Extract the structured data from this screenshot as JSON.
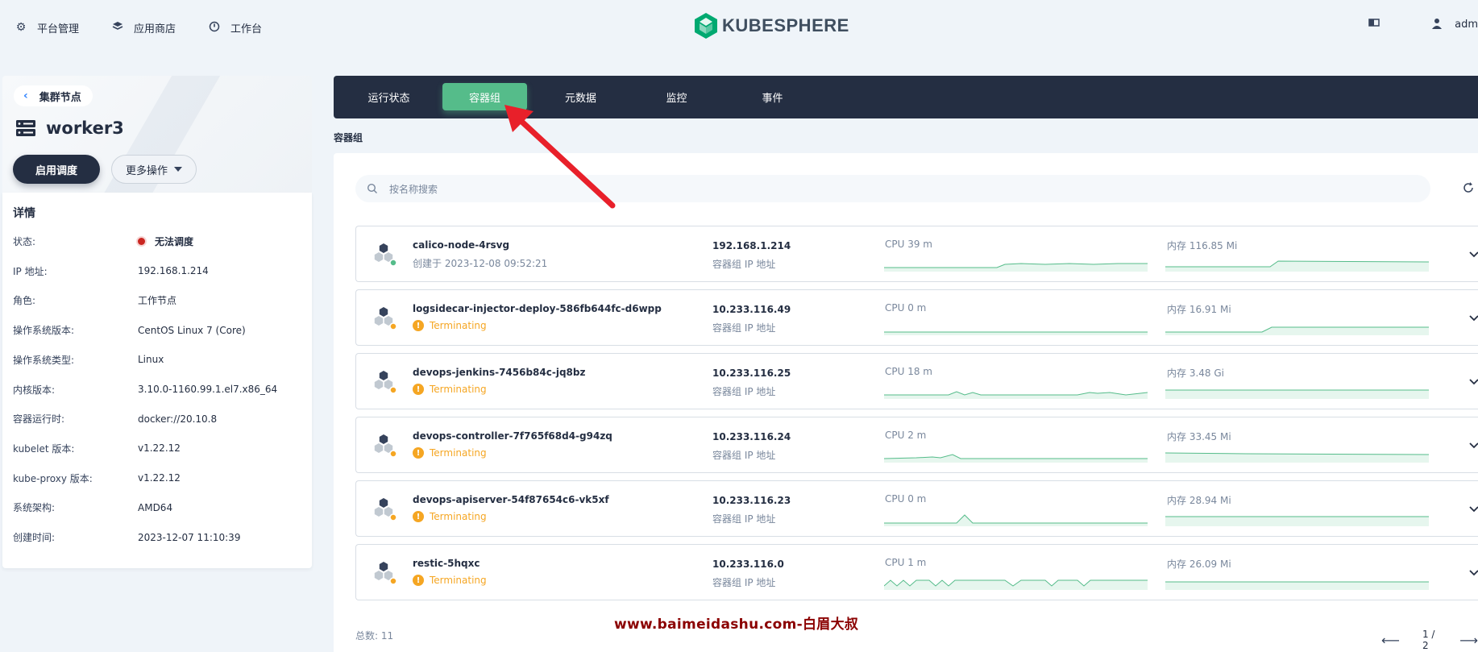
{
  "topnav": {
    "items": [
      {
        "label": "平台管理",
        "icon": "gear-icon"
      },
      {
        "label": "应用商店",
        "icon": "layers-icon"
      },
      {
        "label": "工作台",
        "icon": "workbench-icon"
      }
    ],
    "logo_text": "KUBESPHERE",
    "brand_color": "#00a971",
    "user_label": "adm"
  },
  "left": {
    "back_label": "集群节点",
    "node_name": "worker3",
    "primary_button": "启用调度",
    "more_button": "更多操作",
    "section_title": "详情",
    "details": [
      {
        "key": "状态:",
        "value": "无法调度",
        "status": "error"
      },
      {
        "key": "IP 地址:",
        "value": "192.168.1.214"
      },
      {
        "key": "角色:",
        "value": "工作节点"
      },
      {
        "key": "操作系统版本:",
        "value": "CentOS Linux 7 (Core)"
      },
      {
        "key": "操作系统类型:",
        "value": "Linux"
      },
      {
        "key": "内核版本:",
        "value": "3.10.0-1160.99.1.el7.x86_64"
      },
      {
        "key": "容器运行时:",
        "value": "docker://20.10.8"
      },
      {
        "key": "kubelet 版本:",
        "value": "v1.22.12"
      },
      {
        "key": "kube-proxy 版本:",
        "value": "v1.22.12"
      },
      {
        "key": "系统架构:",
        "value": "AMD64"
      },
      {
        "key": "创建时间:",
        "value": "2023-12-07 11:10:39"
      }
    ]
  },
  "tabs": [
    {
      "label": "运行状态",
      "active": false
    },
    {
      "label": "容器组",
      "active": true
    },
    {
      "label": "元数据",
      "active": false
    },
    {
      "label": "监控",
      "active": false
    },
    {
      "label": "事件",
      "active": false
    }
  ],
  "section_label": "容器组",
  "search_placeholder": "按名称搜索",
  "ip_label": "容器组 IP 地址",
  "pods": [
    {
      "name": "calico-node-4rsvg",
      "status": "创建于 2023-12-08 09:52:21",
      "state": "running",
      "ip": "192.168.1.214",
      "cpu": "CPU 39 m",
      "mem": "内存 116.85 Mi"
    },
    {
      "name": "logsidecar-injector-deploy-586fb644fc-d6wpp",
      "status": "Terminating",
      "state": "terminating",
      "ip": "10.233.116.49",
      "cpu": "CPU 0 m",
      "mem": "内存 16.91 Mi"
    },
    {
      "name": "devops-jenkins-7456b84c-jq8bz",
      "status": "Terminating",
      "state": "terminating",
      "ip": "10.233.116.25",
      "cpu": "CPU 18 m",
      "mem": "内存 3.48 Gi"
    },
    {
      "name": "devops-controller-7f765f68d4-g94zq",
      "status": "Terminating",
      "state": "terminating",
      "ip": "10.233.116.24",
      "cpu": "CPU 2 m",
      "mem": "内存 33.45 Mi"
    },
    {
      "name": "devops-apiserver-54f87654c6-vk5xf",
      "status": "Terminating",
      "state": "terminating",
      "ip": "10.233.116.23",
      "cpu": "CPU 0 m",
      "mem": "内存 28.94 Mi"
    },
    {
      "name": "restic-5hqxc",
      "status": "Terminating",
      "state": "terminating",
      "ip": "10.233.116.0",
      "cpu": "CPU 1 m",
      "mem": "内存 26.09 Mi"
    }
  ],
  "footer": {
    "total": "总数: 11",
    "page": "1 / 2"
  },
  "watermark": "www.baimeidashu.com-白眉大叔",
  "colors": {
    "dark": "#242e42",
    "accent": "#55bc8a",
    "warning": "#f5a623",
    "error": "#ca2621",
    "annotation": "#e8202a"
  }
}
